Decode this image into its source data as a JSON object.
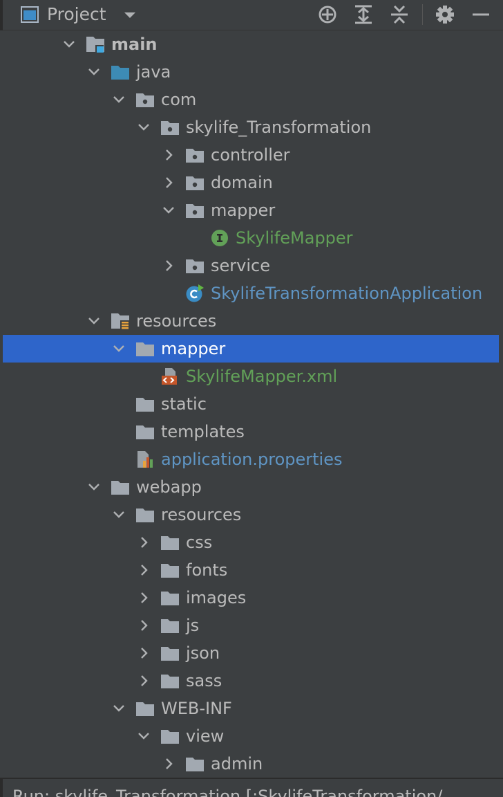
{
  "header": {
    "title": "Project",
    "icons": [
      "project-view-icon",
      "caret-down-icon",
      "locate-icon",
      "expand-all-icon",
      "collapse-all-icon",
      "gear-icon",
      "minimize-icon"
    ]
  },
  "tree": {
    "rows": [
      {
        "label": "main",
        "icon": "source-root-folder-icon",
        "expander": "expanded"
      },
      {
        "label": "java",
        "icon": "java-source-folder-icon",
        "expander": "expanded"
      },
      {
        "label": "com",
        "icon": "package-icon",
        "expander": "expanded"
      },
      {
        "label": "skylife_Transformation",
        "icon": "package-icon",
        "expander": "expanded"
      },
      {
        "label": "controller",
        "icon": "package-icon",
        "expander": "collapsed"
      },
      {
        "label": "domain",
        "icon": "package-icon",
        "expander": "collapsed"
      },
      {
        "label": "mapper",
        "icon": "package-icon",
        "expander": "expanded"
      },
      {
        "label": "SkylifeMapper",
        "icon": "interface-icon",
        "expander": "none"
      },
      {
        "label": "service",
        "icon": "package-icon",
        "expander": "collapsed"
      },
      {
        "label": "SkylifeTransformationApplication",
        "icon": "spring-boot-class-icon",
        "expander": "none"
      },
      {
        "label": "resources",
        "icon": "resources-root-folder-icon",
        "expander": "expanded"
      },
      {
        "label": "mapper",
        "icon": "folder-icon",
        "expander": "expanded",
        "selected": true
      },
      {
        "label": "SkylifeMapper.xml",
        "icon": "xml-file-icon",
        "expander": "none"
      },
      {
        "label": "static",
        "icon": "folder-icon",
        "expander": "none"
      },
      {
        "label": "templates",
        "icon": "folder-icon",
        "expander": "none"
      },
      {
        "label": "application.properties",
        "icon": "properties-file-icon",
        "expander": "none"
      },
      {
        "label": "webapp",
        "icon": "folder-icon",
        "expander": "expanded"
      },
      {
        "label": "resources",
        "icon": "folder-icon",
        "expander": "expanded"
      },
      {
        "label": "css",
        "icon": "folder-icon",
        "expander": "collapsed"
      },
      {
        "label": "fonts",
        "icon": "folder-icon",
        "expander": "collapsed"
      },
      {
        "label": "images",
        "icon": "folder-icon",
        "expander": "collapsed"
      },
      {
        "label": "js",
        "icon": "folder-icon",
        "expander": "collapsed"
      },
      {
        "label": "json",
        "icon": "folder-icon",
        "expander": "collapsed"
      },
      {
        "label": "sass",
        "icon": "folder-icon",
        "expander": "collapsed"
      },
      {
        "label": "WEB-INF",
        "icon": "folder-icon",
        "expander": "expanded"
      },
      {
        "label": "view",
        "icon": "folder-icon",
        "expander": "expanded"
      },
      {
        "label": "admin",
        "icon": "folder-icon",
        "expander": "collapsed"
      }
    ]
  },
  "bottom": {
    "text": "Run:     skylife_Transformation [:SkylifeTransformation/"
  },
  "colors": {
    "background": "#3c3f41",
    "selection": "#2e65ca",
    "text": "#bbbbbb",
    "green_text": "#62a158",
    "blue_text": "#5f95c4",
    "folder": "#a2a9b1",
    "java_folder": "#3d8bb5"
  }
}
